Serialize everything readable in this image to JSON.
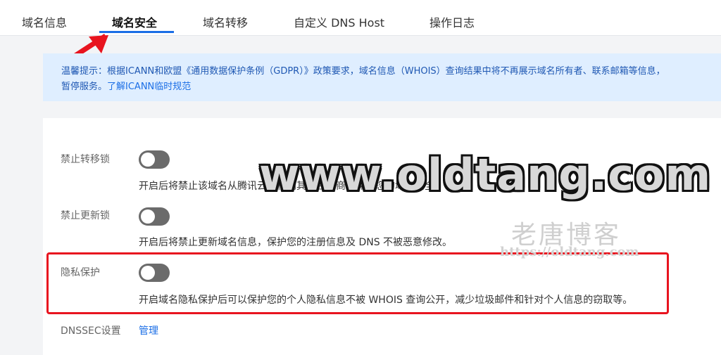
{
  "tabs": [
    {
      "label": "域名信息",
      "active": false
    },
    {
      "label": "域名安全",
      "active": true
    },
    {
      "label": "域名转移",
      "active": false
    },
    {
      "label": "自定义 DNS Host",
      "active": false
    },
    {
      "label": "操作日志",
      "active": false
    }
  ],
  "notice": {
    "line1": "温馨提示：根据ICANN和欧盟《通用数据保护条例（GDPR）》政策要求，域名信息（WHOIS）查询结果中将不再展示域名所有者、联系邮箱等信息，",
    "line2_prefix": "暂停服务。",
    "link": "了解ICANN临时规范"
  },
  "settings": [
    {
      "label": "禁止转移锁",
      "enabled": false,
      "description": "开启后将禁止该域名从腾讯云转移到其他注册商，保护您的域名安全。"
    },
    {
      "label": "禁止更新锁",
      "enabled": false,
      "description": "开启后将禁止更新域名信息，保护您的注册信息及 DNS 不被恶意修改。"
    },
    {
      "label": "隐私保护",
      "enabled": false,
      "description": "开启域名隐私保护后可以保护您的个人隐私信息不被 WHOIS 查询公开，减少垃圾邮件和针对个人信息的窃取等。"
    }
  ],
  "dnssec": {
    "label": "DNSSEC设置",
    "link": "管理"
  },
  "watermark": {
    "main": "www.oldtang.com",
    "cn": "老唐博客",
    "url": "https://oldtang.com"
  },
  "colors": {
    "accent": "#1a6ee6",
    "highlight": "#e8141f",
    "toggle_off": "#6b6b6b"
  }
}
